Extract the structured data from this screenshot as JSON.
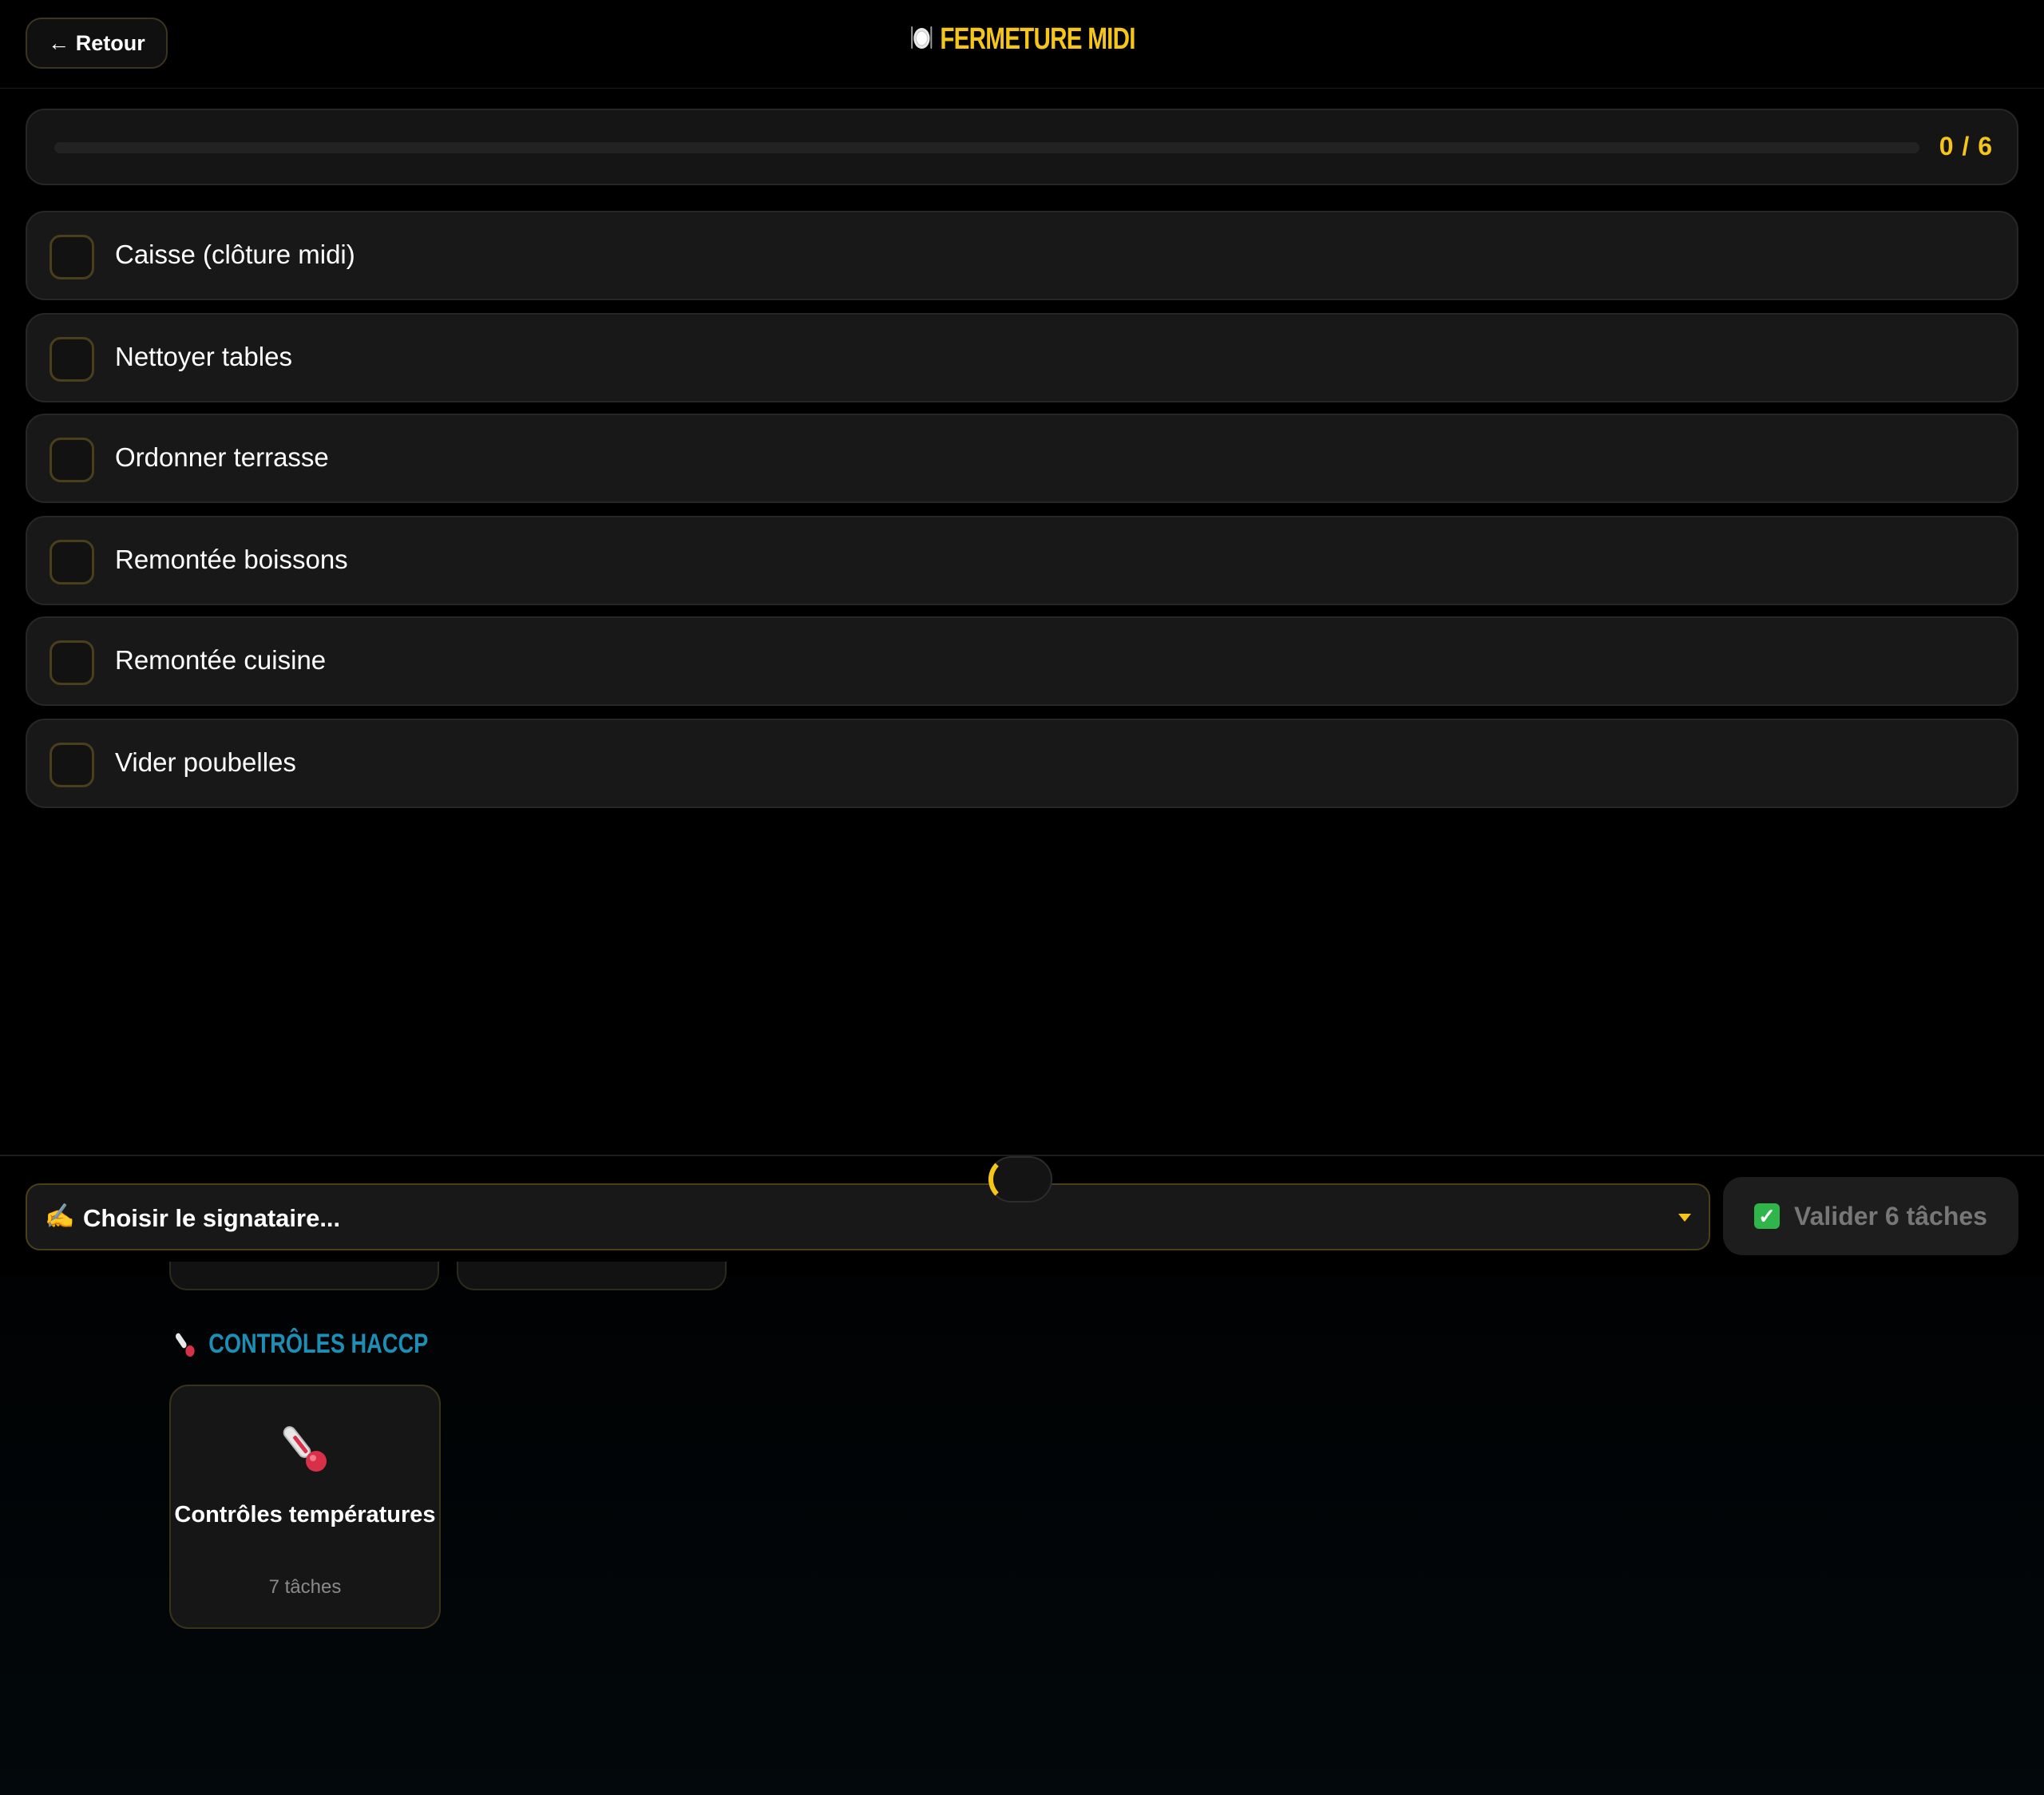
{
  "header": {
    "back_label": "← Retour",
    "title": "FERMETURE MIDI",
    "title_icon": "plate-cutlery-icon"
  },
  "progress": {
    "done": 0,
    "total": 6,
    "label": "0 / 6",
    "fraction": 0
  },
  "tasks": [
    {
      "label": "Caisse (clôture midi)",
      "checked": false
    },
    {
      "label": "Nettoyer tables",
      "checked": false
    },
    {
      "label": "Ordonner terrasse",
      "checked": false
    },
    {
      "label": "Remontée boissons",
      "checked": false
    },
    {
      "label": "Remontée cuisine",
      "checked": false
    },
    {
      "label": "Vider poubelles",
      "checked": false
    }
  ],
  "footer": {
    "signer_icon": "writing-hand-icon",
    "signer_placeholder": "Choisir le signataire...",
    "validate_label": "Valider 6 tâches",
    "validate_icon": "check-mark-button-icon"
  },
  "haccp": {
    "section_title": "CONTRÔLES HACCP",
    "section_icon": "thermometer-icon",
    "cards": [
      {
        "title": "Contrôles températures",
        "subtitle": "7 tâches",
        "icon": "thermometer-icon"
      }
    ]
  },
  "colors": {
    "accent": "#f5c518",
    "section_accent": "#1c8fb6",
    "background": "#000000",
    "card": "#181818",
    "check_green": "#2fb54a"
  }
}
